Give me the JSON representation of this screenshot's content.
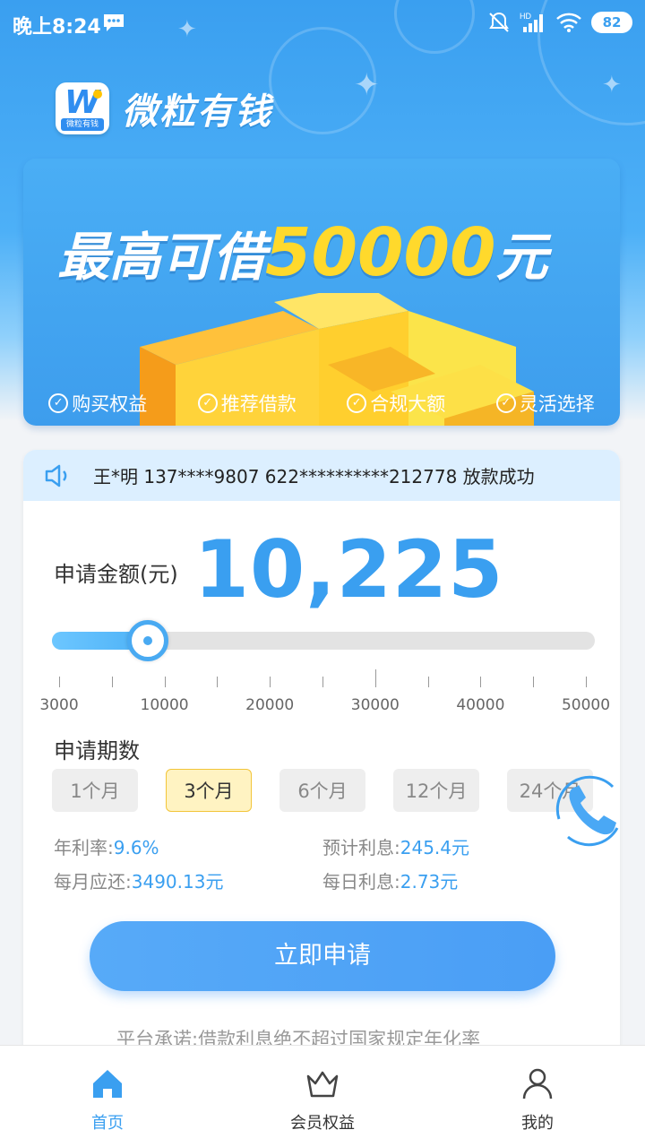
{
  "status_bar": {
    "time": "晚上8:24",
    "battery": "82",
    "network": "HD"
  },
  "app": {
    "name": "微粒有钱",
    "logo_small_text": "微粒有钱",
    "logo_letter": "W"
  },
  "banner": {
    "title_prefix": "最高可借",
    "title_amount": "50000",
    "title_suffix": "元",
    "features": [
      "购买权益",
      "推荐借款",
      "合规大额",
      "灵活选择"
    ]
  },
  "notice": {
    "text": "王*明 137****9807 622**********212778 放款成功"
  },
  "loan": {
    "amount_label": "申请金额(元)",
    "amount_value": "10,225",
    "slider": {
      "min": 3000,
      "max": 50000,
      "value": 10225,
      "tick_labels": [
        "3000",
        "10000",
        "20000",
        "30000",
        "40000",
        "50000"
      ]
    },
    "period_title": "申请期数",
    "periods": [
      "1个月",
      "3个月",
      "6个月",
      "12个月",
      "24个月"
    ],
    "selected_period": "3个月",
    "info": {
      "annual_rate_label": "年利率:",
      "annual_rate_value": "9.6%",
      "expected_interest_label": "预计利息:",
      "expected_interest_value": "245.4元",
      "monthly_label": "每月应还:",
      "monthly_value": "3490.13元",
      "daily_label": "每日利息:",
      "daily_value": "2.73元"
    },
    "apply_button": "立即申请",
    "promise": "平台承诺:借款利息绝不超过国家规定年化率"
  },
  "bottom_nav": [
    {
      "label": "首页",
      "icon": "home-icon",
      "active": true
    },
    {
      "label": "会员权益",
      "icon": "crown-icon",
      "active": false
    },
    {
      "label": "我的",
      "icon": "user-icon",
      "active": false
    }
  ],
  "colors": {
    "primary": "#3a9ff0",
    "highlight_yellow": "#ffd92c",
    "selected_period_bg": "#fff3c2"
  }
}
